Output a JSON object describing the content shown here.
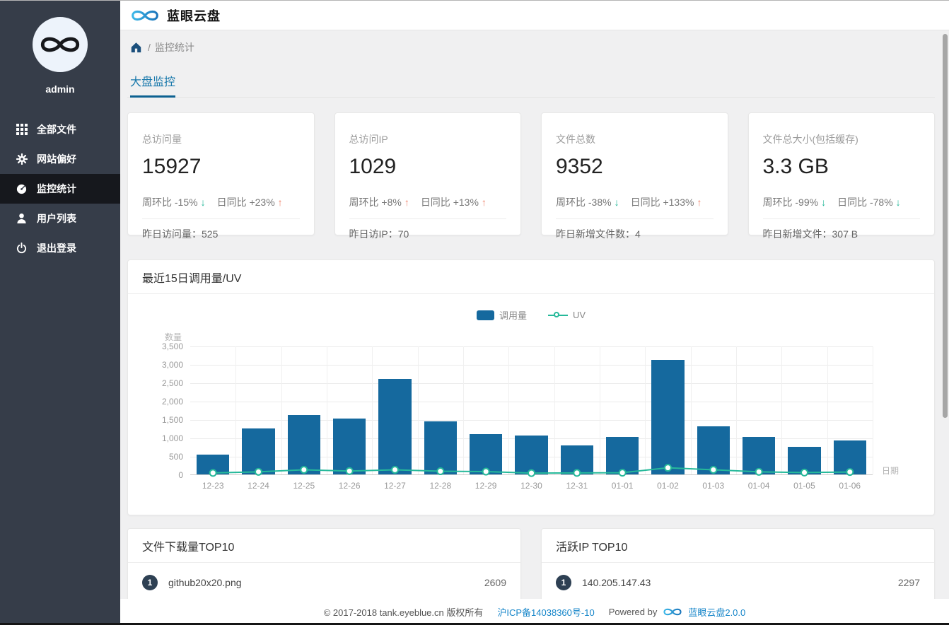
{
  "app": {
    "title": "蓝眼云盘"
  },
  "sidebar": {
    "username": "admin",
    "items": [
      {
        "label": "全部文件",
        "icon": "grid-icon",
        "active": false
      },
      {
        "label": "网站偏好",
        "icon": "gear-icon",
        "active": false
      },
      {
        "label": "监控统计",
        "icon": "dashboard-icon",
        "active": true
      },
      {
        "label": "用户列表",
        "icon": "user-icon",
        "active": false
      },
      {
        "label": "退出登录",
        "icon": "power-icon",
        "active": false
      }
    ]
  },
  "breadcrumb": {
    "home_icon": "home-icon",
    "separator": "/",
    "current": "监控统计"
  },
  "tabs": [
    {
      "label": "大盘监控",
      "active": true
    }
  ],
  "stat_cards": [
    {
      "label": "总访问量",
      "value": "15927",
      "week_label": "周环比",
      "week_value": "-15%",
      "week_dir": "down",
      "day_label": "日同比",
      "day_value": "+23%",
      "day_dir": "up",
      "footer_label": "昨日访问量：",
      "footer_value": "525"
    },
    {
      "label": "总访问IP",
      "value": "1029",
      "week_label": "周环比",
      "week_value": "+8%",
      "week_dir": "up",
      "day_label": "日同比",
      "day_value": "+13%",
      "day_dir": "up",
      "footer_label": "昨日访IP：",
      "footer_value": "70"
    },
    {
      "label": "文件总数",
      "value": "9352",
      "week_label": "周环比",
      "week_value": "-38%",
      "week_dir": "down",
      "day_label": "日同比",
      "day_value": "+133%",
      "day_dir": "up",
      "footer_label": "昨日新增文件数：",
      "footer_value": "4"
    },
    {
      "label": "文件总大小(包括缓存)",
      "value": "3.3 GB",
      "week_label": "周环比",
      "week_value": "-99%",
      "week_dir": "down",
      "day_label": "日同比",
      "day_value": "-78%",
      "day_dir": "down",
      "footer_label": "昨日新增文件：",
      "footer_value": "307 B"
    }
  ],
  "chart_card": {
    "title": "最近15日调用量/UV"
  },
  "chart_data": {
    "type": "bar",
    "title": "最近15日调用量/UV",
    "categories": [
      "12-23",
      "12-24",
      "12-25",
      "12-26",
      "12-27",
      "12-28",
      "12-29",
      "12-30",
      "12-31",
      "01-01",
      "01-02",
      "01-03",
      "01-04",
      "01-05",
      "01-06"
    ],
    "series": [
      {
        "name": "调用量",
        "type": "bar",
        "color": "#15699e",
        "values": [
          530,
          1250,
          1620,
          1520,
          2600,
          1450,
          1090,
          1050,
          790,
          1010,
          3110,
          1310,
          1020,
          750,
          930
        ]
      },
      {
        "name": "UV",
        "type": "line",
        "color": "#26b99a",
        "values": [
          60,
          90,
          145,
          110,
          145,
          105,
          95,
          55,
          60,
          65,
          200,
          145,
          90,
          70,
          85
        ]
      }
    ],
    "xlabel": "日期",
    "ylabel": "数量",
    "ylim": [
      0,
      3500
    ],
    "ytick_step": 500,
    "ytick_labels": [
      "0",
      "500",
      "1,000",
      "1,500",
      "2,000",
      "2,500",
      "3,000",
      "3,500"
    ],
    "grid": true,
    "legend_position": "top-center"
  },
  "top_lists": [
    {
      "title": "文件下载量TOP10",
      "rows": [
        {
          "rank": "1",
          "name": "github20x20.png",
          "value": "2609"
        }
      ]
    },
    {
      "title": "活跃IP TOP10",
      "rows": [
        {
          "rank": "1",
          "name": "140.205.147.43",
          "value": "2297"
        }
      ]
    }
  ],
  "footer": {
    "copyright": "© 2017-2018 tank.eyeblue.cn 版权所有",
    "icp_link": "沪ICP备14038360号-10",
    "powered_by": "Powered by",
    "product_link": "蓝眼云盘2.0.0"
  },
  "colors": {
    "sidebar_bg": "#363d49",
    "sidebar_active_bg": "#16181d",
    "accent_blue": "#1878ab",
    "tab_underline": "#0d6191",
    "bar_color": "#15699e",
    "uv_color": "#26b99a",
    "up_arrow": "#ee8168",
    "down_arrow": "#26b99a",
    "link_blue": "#1585c9",
    "badge_bg": "#2e4053"
  }
}
